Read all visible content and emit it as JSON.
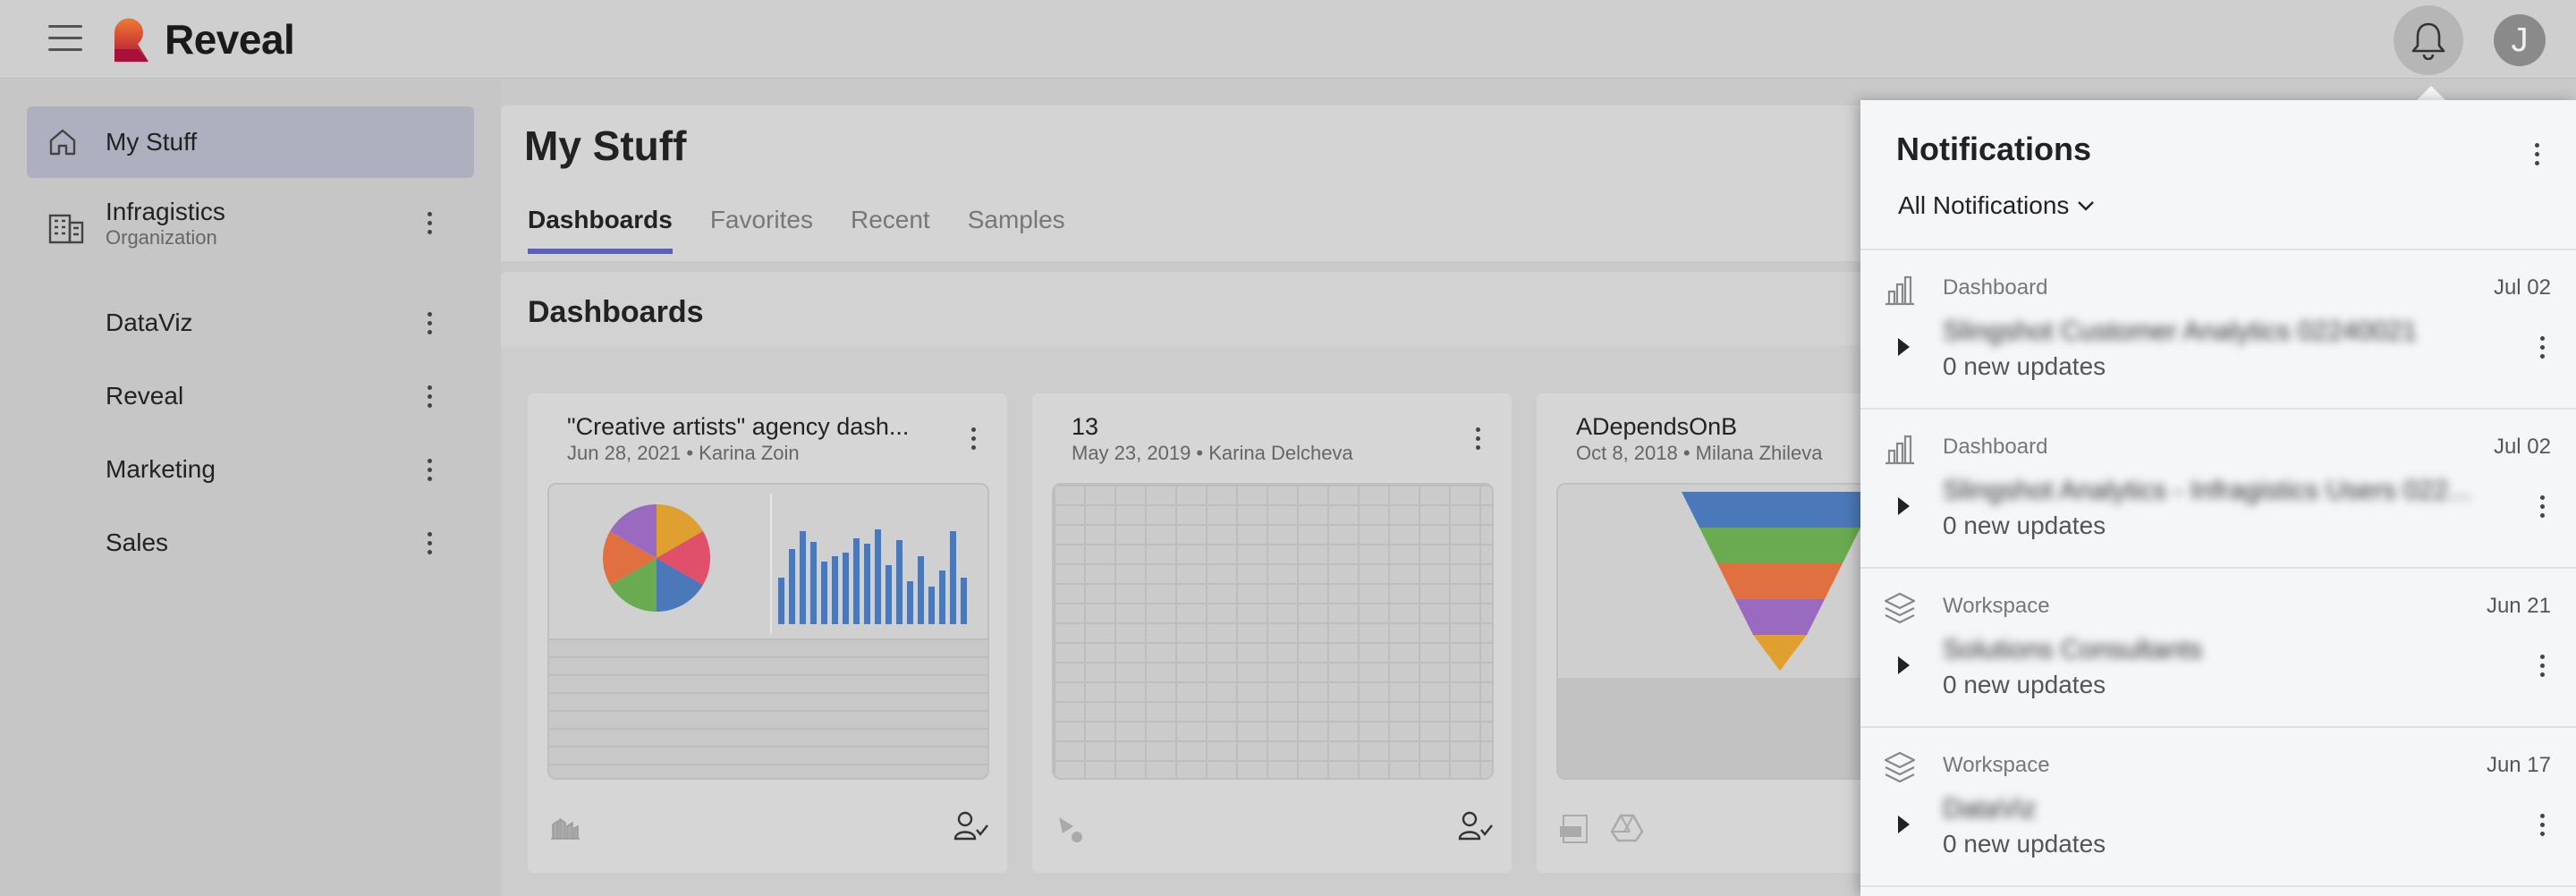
{
  "app": {
    "name": "Reveal",
    "user_initial": "J"
  },
  "sidebar": {
    "items": [
      {
        "label": "My Stuff",
        "sub": ""
      },
      {
        "label": "Infragistics",
        "sub": "Organization"
      },
      {
        "label": "DataViz",
        "sub": ""
      },
      {
        "label": "Reveal",
        "sub": ""
      },
      {
        "label": "Marketing",
        "sub": ""
      },
      {
        "label": "Sales",
        "sub": ""
      }
    ]
  },
  "main": {
    "title": "My Stuff",
    "tabs": [
      "Dashboards",
      "Favorites",
      "Recent",
      "Samples"
    ],
    "section_title": "Dashboards",
    "cards": [
      {
        "title": "\"Creative artists\" agency dash...",
        "meta": "Jun 28, 2021 • Karina Zoin"
      },
      {
        "title": "13",
        "meta": "May 23, 2019 • Karina Delcheva"
      },
      {
        "title": "ADependsOnB",
        "meta": "Oct 8, 2018 • Milana Zhileva"
      }
    ]
  },
  "notifications": {
    "title": "Notifications",
    "filter": "All Notifications",
    "items": [
      {
        "type": "Dashboard",
        "date": "Jul 02",
        "name": "Slingshot Customer Analytics 02240021",
        "updates": "0 new updates",
        "icon": "bar-chart-icon"
      },
      {
        "type": "Dashboard",
        "date": "Jul 02",
        "name": "Slingshot Analytics - Infragistics Users 022...",
        "updates": "0 new updates",
        "icon": "bar-chart-icon"
      },
      {
        "type": "Workspace",
        "date": "Jun 21",
        "name": "Solutions Consultants",
        "updates": "0 new updates",
        "icon": "layers-icon"
      },
      {
        "type": "Workspace",
        "date": "Jun 17",
        "name": "DataViz",
        "updates": "0 new updates",
        "icon": "layers-icon"
      }
    ]
  },
  "colors": {
    "accent": "#5a63b8",
    "logo_top": "#e8552e",
    "logo_bottom": "#b0113f"
  }
}
